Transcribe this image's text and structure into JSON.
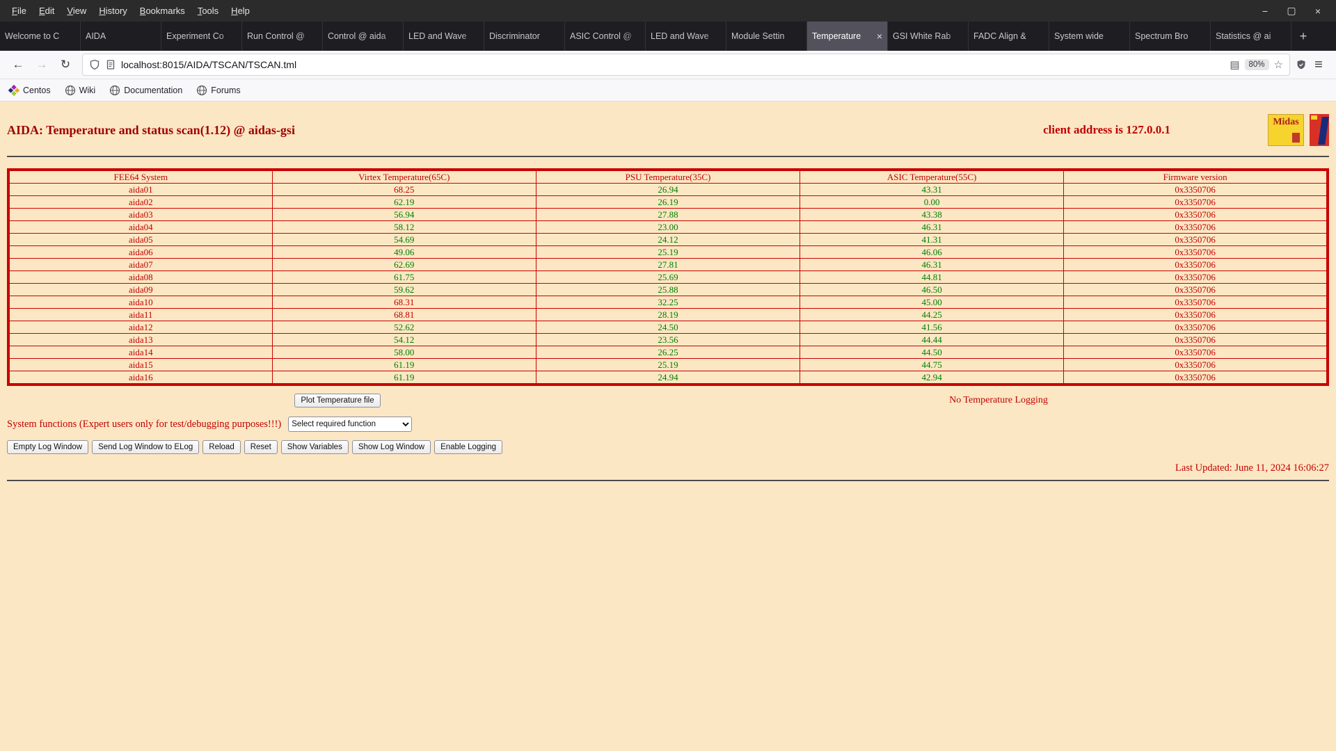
{
  "colors": {
    "page_background": "#fce7c4",
    "accent_red": "#c00000",
    "title_red": "#a00000",
    "ok_green": "#008000",
    "table_border_red": "#c90000"
  },
  "browser": {
    "menubar": {
      "items": [
        "File",
        "Edit",
        "View",
        "History",
        "Bookmarks",
        "Tools",
        "Help"
      ]
    },
    "window_controls": {
      "minimize": "−",
      "maximize": "▢",
      "close": "×"
    },
    "tabs": [
      "Welcome to C",
      "AIDA",
      "Experiment Co",
      "Run Control @",
      "Control @ aida",
      "LED and Wave",
      "Discriminator",
      "ASIC Control @",
      "LED and Wave",
      "Module Settin",
      "Temperature",
      "GSI White Rab",
      "FADC Align &",
      "System wide",
      "Spectrum Bro",
      "Statistics @ ai"
    ],
    "active_tab_index": 10,
    "tab_close_glyph": "×",
    "new_tab_label": "+",
    "navbar": {
      "back": "←",
      "forward": "→",
      "reload": "↻",
      "url": "localhost:8015/AIDA/TSCAN/TSCAN.tml",
      "zoom": "80%",
      "star": "☆",
      "reader": "▤",
      "menu": "≡"
    },
    "bookmarks": [
      "Centos",
      "Wiki",
      "Documentation",
      "Forums"
    ]
  },
  "page": {
    "title": "AIDA: Temperature and status scan(1.12) @ aidas-gsi",
    "client_address": "client address is 127.0.0.1",
    "midas_logo_text": "Midas",
    "table": {
      "headers": [
        "FEE64 System",
        "Virtex Temperature(65C)",
        "PSU Temperature(35C)",
        "ASIC Temperature(55C)",
        "Firmware version"
      ],
      "rows": [
        {
          "system": "aida01",
          "temps": [
            "68.25",
            "26.94",
            "43.31"
          ],
          "temp_colors": [
            "red",
            "green",
            "green"
          ],
          "firmware": "0x3350706"
        },
        {
          "system": "aida02",
          "temps": [
            "62.19",
            "26.19",
            "0.00"
          ],
          "temp_colors": [
            "green",
            "green",
            "green"
          ],
          "firmware": "0x3350706"
        },
        {
          "system": "aida03",
          "temps": [
            "56.94",
            "27.88",
            "43.38"
          ],
          "temp_colors": [
            "green",
            "green",
            "green"
          ],
          "firmware": "0x3350706"
        },
        {
          "system": "aida04",
          "temps": [
            "58.12",
            "23.00",
            "46.31"
          ],
          "temp_colors": [
            "green",
            "green",
            "green"
          ],
          "firmware": "0x3350706"
        },
        {
          "system": "aida05",
          "temps": [
            "54.69",
            "24.12",
            "41.31"
          ],
          "temp_colors": [
            "green",
            "green",
            "green"
          ],
          "firmware": "0x3350706"
        },
        {
          "system": "aida06",
          "temps": [
            "49.06",
            "25.19",
            "46.06"
          ],
          "temp_colors": [
            "green",
            "green",
            "green"
          ],
          "firmware": "0x3350706"
        },
        {
          "system": "aida07",
          "temps": [
            "62.69",
            "27.81",
            "46.31"
          ],
          "temp_colors": [
            "green",
            "green",
            "green"
          ],
          "firmware": "0x3350706"
        },
        {
          "system": "aida08",
          "temps": [
            "61.75",
            "25.69",
            "44.81"
          ],
          "temp_colors": [
            "green",
            "green",
            "green"
          ],
          "firmware": "0x3350706"
        },
        {
          "system": "aida09",
          "temps": [
            "59.62",
            "25.88",
            "46.50"
          ],
          "temp_colors": [
            "green",
            "green",
            "green"
          ],
          "firmware": "0x3350706"
        },
        {
          "system": "aida10",
          "temps": [
            "68.31",
            "32.25",
            "45.00"
          ],
          "temp_colors": [
            "red",
            "green",
            "green"
          ],
          "firmware": "0x3350706"
        },
        {
          "system": "aida11",
          "temps": [
            "68.81",
            "28.19",
            "44.25"
          ],
          "temp_colors": [
            "red",
            "green",
            "green"
          ],
          "firmware": "0x3350706"
        },
        {
          "system": "aida12",
          "temps": [
            "52.62",
            "24.50",
            "41.56"
          ],
          "temp_colors": [
            "green",
            "green",
            "green"
          ],
          "firmware": "0x3350706"
        },
        {
          "system": "aida13",
          "temps": [
            "54.12",
            "23.56",
            "44.44"
          ],
          "temp_colors": [
            "green",
            "green",
            "green"
          ],
          "firmware": "0x3350706"
        },
        {
          "system": "aida14",
          "temps": [
            "58.00",
            "26.25",
            "44.50"
          ],
          "temp_colors": [
            "green",
            "green",
            "green"
          ],
          "firmware": "0x3350706"
        },
        {
          "system": "aida15",
          "temps": [
            "61.19",
            "25.19",
            "44.75"
          ],
          "temp_colors": [
            "green",
            "green",
            "green"
          ],
          "firmware": "0x3350706"
        },
        {
          "system": "aida16",
          "temps": [
            "61.19",
            "24.94",
            "42.94"
          ],
          "temp_colors": [
            "green",
            "green",
            "green"
          ],
          "firmware": "0x3350706"
        }
      ]
    },
    "plot_button": "Plot Temperature file",
    "logging_status": "No Temperature Logging",
    "system_functions_label": "System functions (Expert users only for test/debugging purposes!!!)",
    "function_select_value": "Select required function",
    "action_buttons": [
      "Empty Log Window",
      "Send Log Window to ELog",
      "Reload",
      "Reset",
      "Show Variables",
      "Show Log Window",
      "Enable Logging"
    ],
    "last_updated": "Last Updated: June 11, 2024 16:06:27"
  }
}
